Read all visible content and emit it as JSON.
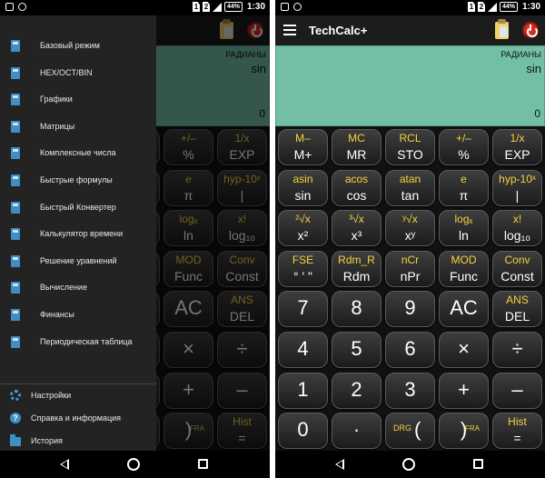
{
  "status_bar": {
    "sim1": "1",
    "sim2": "2",
    "battery": "44%",
    "time": "1:30"
  },
  "app_bar": {
    "title": "TechCalc+"
  },
  "display": {
    "mode": "РАДИАНЫ",
    "expression": "sin",
    "result": "0"
  },
  "keypad": {
    "rows": [
      [
        {
          "top": "M–",
          "main": "M+"
        },
        {
          "top": "MC",
          "main": "MR"
        },
        {
          "top": "RCL",
          "main": "STO"
        },
        {
          "top": "+/–",
          "main": "%"
        },
        {
          "top": "1/x",
          "main": "EXP"
        }
      ],
      [
        {
          "top": "asin",
          "main": "sin"
        },
        {
          "top": "acos",
          "main": "cos"
        },
        {
          "top": "atan",
          "main": "tan"
        },
        {
          "top": "e",
          "main": "π"
        },
        {
          "top": "hyp-10ˣ",
          "main": "|"
        }
      ],
      [
        {
          "top": "²√x",
          "main": "x²"
        },
        {
          "top": "³√x",
          "main": "x³"
        },
        {
          "top": "ʸ√x",
          "main": "xʸ"
        },
        {
          "top": "logₓ",
          "main": "ln"
        },
        {
          "top": "x!",
          "main": "log₁₀"
        }
      ],
      [
        {
          "top": "FSE",
          "main": "° ' \""
        },
        {
          "top": "Rdm_R",
          "main": "Rdm"
        },
        {
          "top": "nCr",
          "main": "nPr"
        },
        {
          "top": "MOD",
          "main": "Func"
        },
        {
          "top": "Conv",
          "main": "Const"
        }
      ],
      [
        {
          "main": "7",
          "big": true
        },
        {
          "main": "8",
          "big": true
        },
        {
          "main": "9",
          "big": true
        },
        {
          "main": "AC",
          "big": true
        },
        {
          "top": "ANS",
          "main": "DEL"
        }
      ],
      [
        {
          "main": "4",
          "big": true
        },
        {
          "main": "5",
          "big": true
        },
        {
          "main": "6",
          "big": true
        },
        {
          "main": "×",
          "big": true
        },
        {
          "main": "÷",
          "big": true
        }
      ],
      [
        {
          "main": "1",
          "big": true
        },
        {
          "main": "2",
          "big": true
        },
        {
          "main": "3",
          "big": true
        },
        {
          "main": "+",
          "big": true
        },
        {
          "main": "–",
          "big": true
        }
      ],
      [
        {
          "main": "0",
          "big": true
        },
        {
          "main": "·",
          "big": true
        },
        {
          "side": "DRG",
          "paren": "(",
          "special": "drg"
        },
        {
          "main": ")",
          "big": true,
          "fra": "FRA"
        },
        {
          "top": "Hist",
          "main": "="
        }
      ]
    ]
  },
  "drawer": {
    "items": [
      {
        "label": "Базовый режим",
        "icon": "calculator-icon"
      },
      {
        "label": "HEX/OCT/BIN",
        "icon": "calculator-icon"
      },
      {
        "label": "Графики",
        "icon": "calculator-icon"
      },
      {
        "label": "Матрицы",
        "icon": "calculator-icon"
      },
      {
        "label": "Комплексные числа",
        "icon": "calculator-icon"
      },
      {
        "label": "Быстрые формулы",
        "icon": "calculator-icon"
      },
      {
        "label": "Быстрый Конвертер",
        "icon": "calculator-icon"
      },
      {
        "label": "Калькулятор времени",
        "icon": "calculator-icon"
      },
      {
        "label": "Решение уравнений",
        "icon": "calculator-icon"
      },
      {
        "label": "Вычисление",
        "icon": "calculator-icon"
      },
      {
        "label": "Финансы",
        "icon": "calculator-icon"
      },
      {
        "label": "Периодическая таблица",
        "icon": "calculator-icon"
      }
    ],
    "footer": [
      {
        "label": "Настройки",
        "icon": "gear-icon"
      },
      {
        "label": "Справка и информация",
        "icon": "help-icon"
      },
      {
        "label": "История",
        "icon": "folder-icon"
      }
    ]
  },
  "colors": {
    "display_bg": "#73bfa6",
    "secondary_label": "#f3d33f",
    "drawer_icon": "#3f8fc4",
    "power_button": "#d52b22"
  }
}
